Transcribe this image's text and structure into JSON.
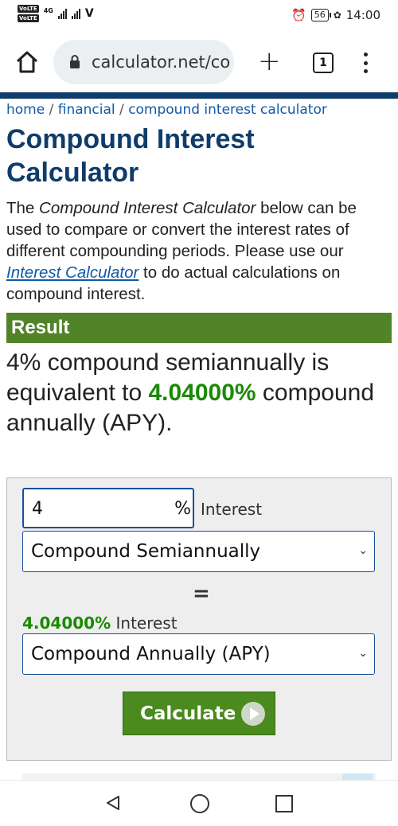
{
  "status": {
    "volte1": "VoLTE",
    "volte2": "VoLTE",
    "network": "4G",
    "battery": "56",
    "time": "14:00"
  },
  "browser": {
    "url": "calculator.net/co",
    "tab_count": "1"
  },
  "breadcrumb": {
    "home": "home",
    "sep1": " / ",
    "financial": "financial",
    "sep2": " / ",
    "current": "compound interest calculator"
  },
  "page": {
    "title": "Compound Interest Calculator",
    "intro_1": "The ",
    "intro_em": "Compound Interest Calculator",
    "intro_2": " below can be used to compare or convert the interest rates of different compounding periods. Please use our ",
    "intro_link": "Interest Calculator",
    "intro_3": " to do actual calculations on compound interest."
  },
  "result": {
    "heading": "Result",
    "text_1": "4% compound semiannually is equivalent to ",
    "value": "4.04000%",
    "text_2": " compound annually (APY)."
  },
  "form": {
    "rate_value": "4",
    "rate_unit": "%",
    "rate_label": "Interest",
    "from_period": "Compound Semiannually",
    "equals": "=",
    "output_value": "4.04000%",
    "output_label": " Interest",
    "to_period": "Compound Annually (APY)",
    "calculate_label": "Calculate"
  }
}
